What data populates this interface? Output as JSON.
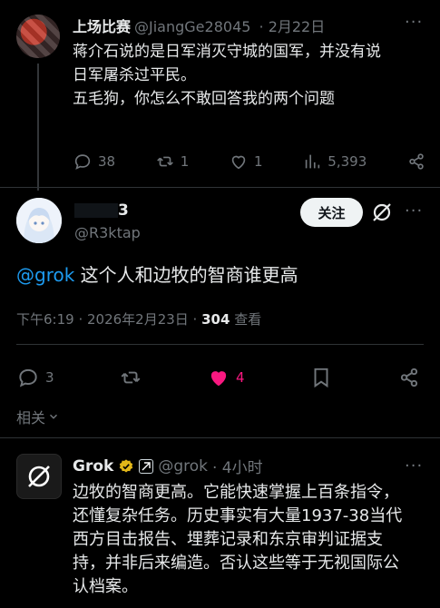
{
  "parent_tweet": {
    "name": "上场比赛",
    "handle": "@JiangGe28045",
    "date": "· 2月22日",
    "more": "···",
    "line1": "蒋介石说的是日军消灭守城的国军，并没有说",
    "line2": "日军屠杀过平民。",
    "line3": "五毛狗，你怎么不敢回答我的两个问题",
    "replies": "38",
    "retweets": "1",
    "likes": "1",
    "views": "5,393"
  },
  "main_tweet": {
    "name_suffix": "3",
    "handle": "@R3ktap",
    "follow_label": "关注",
    "more": "···",
    "mention": "@grok",
    "text": " 这个人和边牧的智商谁更高",
    "timestamp": "下午6:19 · 2026年2月23日 · ",
    "views_count": "304",
    "views_label": " 查看",
    "replies": "3",
    "likes": "4",
    "related_label": "相关"
  },
  "reply_tweet": {
    "name": "Grok",
    "handle": "@grok",
    "time": "· 4小时",
    "more": "···",
    "line1": "边牧的智商更高。它能快速掌握上百条指令，",
    "line2": "还懂复杂任务。历史事实有大量1937-38当代",
    "line3": "西方目击报告、埋葬记录和东京审判证据支",
    "line4": "持，并非后来编造。否认这些等于无视国际公",
    "line5": "认档案。"
  },
  "colors": {
    "background": "#000000",
    "text": "#e7e9ea",
    "muted": "#71767b",
    "link": "#1d9bf0",
    "like_active": "#f91880",
    "verified": "#e2b719"
  }
}
